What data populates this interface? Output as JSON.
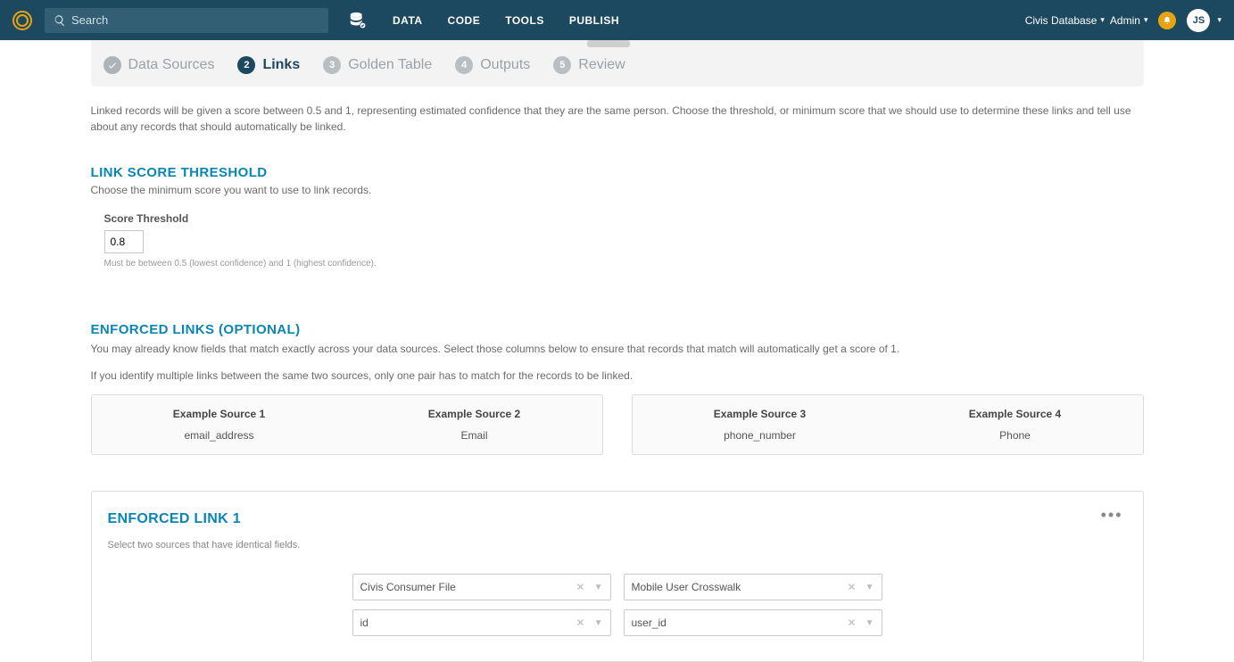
{
  "topbar": {
    "search_placeholder": "Search",
    "nav": {
      "data": "DATA",
      "code": "CODE",
      "tools": "TOOLS",
      "publish": "PUBLISH"
    },
    "database_label": "Civis Database",
    "admin_label": "Admin",
    "avatar_initials": "JS"
  },
  "steps": [
    {
      "label": "Data Sources",
      "state": "done"
    },
    {
      "num": "2",
      "label": "Links",
      "state": "active"
    },
    {
      "num": "3",
      "label": "Golden Table",
      "state": "pending"
    },
    {
      "num": "4",
      "label": "Outputs",
      "state": "pending"
    },
    {
      "num": "5",
      "label": "Review",
      "state": "pending"
    }
  ],
  "intro_text": "Linked records will be given a score between 0.5 and 1, representing estimated confidence that they are the same person. Choose the threshold, or minimum score that we should use to determine these links and tell use about any records that should automatically be linked.",
  "threshold": {
    "section_title": "LINK SCORE THRESHOLD",
    "section_sub": "Choose the minimum score you want to use to link records.",
    "field_label": "Score Threshold",
    "value": "0.8",
    "help": "Must be between 0.5 (lowest confidence) and 1 (highest confidence)."
  },
  "enforced": {
    "section_title": "ENFORCED LINKS (OPTIONAL)",
    "para1": "You may already know fields that match exactly across your data sources. Select those columns below to ensure that records that match will automatically get a score of 1.",
    "para2": "If you identify multiple links between the same two sources, only one pair has to match for the records to be linked.",
    "examples": [
      {
        "header": "Example Source 1",
        "value": "email_address"
      },
      {
        "header": "Example Source 2",
        "value": "Email"
      },
      {
        "header": "Example Source 3",
        "value": "phone_number"
      },
      {
        "header": "Example Source 4",
        "value": "Phone"
      }
    ],
    "link1": {
      "title": "ENFORCED LINK 1",
      "sub": "Select two sources that have identical fields.",
      "selects": {
        "source_a": "Civis Consumer File",
        "source_b": "Mobile User Crosswalk",
        "field_a": "id",
        "field_b": "user_id"
      }
    }
  }
}
